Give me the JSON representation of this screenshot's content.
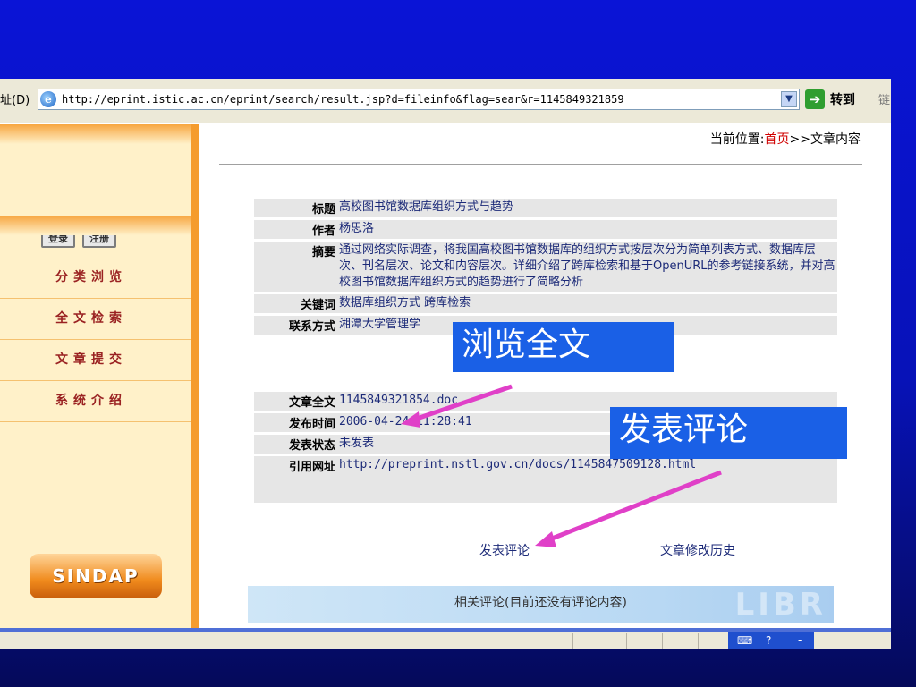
{
  "browser": {
    "address_label": "址(D)",
    "address_url": "http://eprint.istic.ac.cn/eprint/search/result.jsp?d=fileinfo&flag=sear&r=1145849321859",
    "go_label": "转到",
    "links_label": "链"
  },
  "sidebar": {
    "login_button": "登录",
    "register_button": "注册",
    "nav_items": [
      "分类浏览",
      "全文检索",
      "文章提交",
      "系统介绍"
    ],
    "logo_text": "SINDAP"
  },
  "breadcrumb": {
    "prefix": "当前位置:",
    "home": "首页",
    "current": ">>文章内容"
  },
  "record": {
    "title_label": "标题",
    "title_value": "高校图书馆数据库组织方式与趋势",
    "author_label": "作者",
    "author_value": "杨思洛",
    "abstract_label": "摘要",
    "abstract_value": "通过网络实际调查，将我国高校图书馆数据库的组织方式按层次分为简单列表方式、数据库层次、刊名层次、论文和内容层次。详细介绍了跨库检索和基于OpenURL的参考链接系统，并对高校图书馆数据库组织方式的趋势进行了简略分析",
    "keywords_label": "关键词",
    "keywords_value": "数据库组织方式 跨库检索",
    "contact_label": "联系方式",
    "contact_value": "湘潭大学管理学",
    "fulltext_label": "文章全文",
    "fulltext_value": "1145849321854.doc",
    "pubtime_label": "发布时间",
    "pubtime_value": "2006-04-24 11:28:41",
    "status_label": "发表状态",
    "status_value": "未发表",
    "cite_label": "引用网址",
    "cite_value": "http://preprint.nstl.gov.cn/docs/1145847509128.html"
  },
  "actions": {
    "comment_link": "发表评论",
    "history_link": "文章修改历史"
  },
  "related": {
    "text": "相关评论(目前还没有评论内容)",
    "watermark": "LIBR"
  },
  "callouts": {
    "browse_fulltext": "浏览全文",
    "post_comment": "发表评论"
  },
  "colors": {
    "slide_background": "#0a14d6",
    "callout": "#1a60e6",
    "arrow": "#e040c8",
    "sidebar_accent": "#f59c2d"
  }
}
